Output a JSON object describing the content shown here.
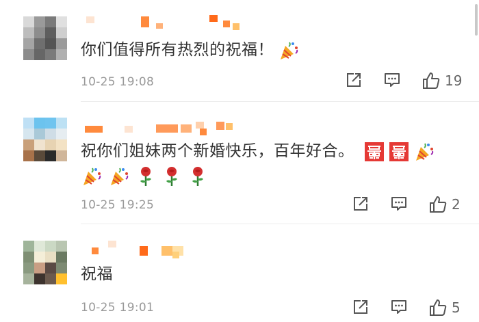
{
  "comments": [
    {
      "text": "你们值得所有热烈的祝福！",
      "emojis": [
        "party-popper"
      ],
      "time": "10-25 19:08",
      "likes": "19"
    },
    {
      "text": "祝你们姐妹两个新婚快乐，百年好合。",
      "emojis_inline": [
        "double-happiness",
        "double-happiness",
        "party-popper"
      ],
      "emojis_row": [
        "party-popper",
        "party-popper",
        "rose",
        "rose",
        "rose"
      ],
      "time": "10-25 19:25",
      "likes": "2"
    },
    {
      "text": "祝福",
      "time": "10-25 19:01",
      "likes": "5"
    }
  ],
  "icons": {
    "share": "share-icon",
    "comment": "comment-icon",
    "like": "thumbs-up-icon"
  },
  "colors": {
    "text": "#333333",
    "time": "#999999",
    "icon": "#555555",
    "username_pixel": "#ff8a3d"
  }
}
